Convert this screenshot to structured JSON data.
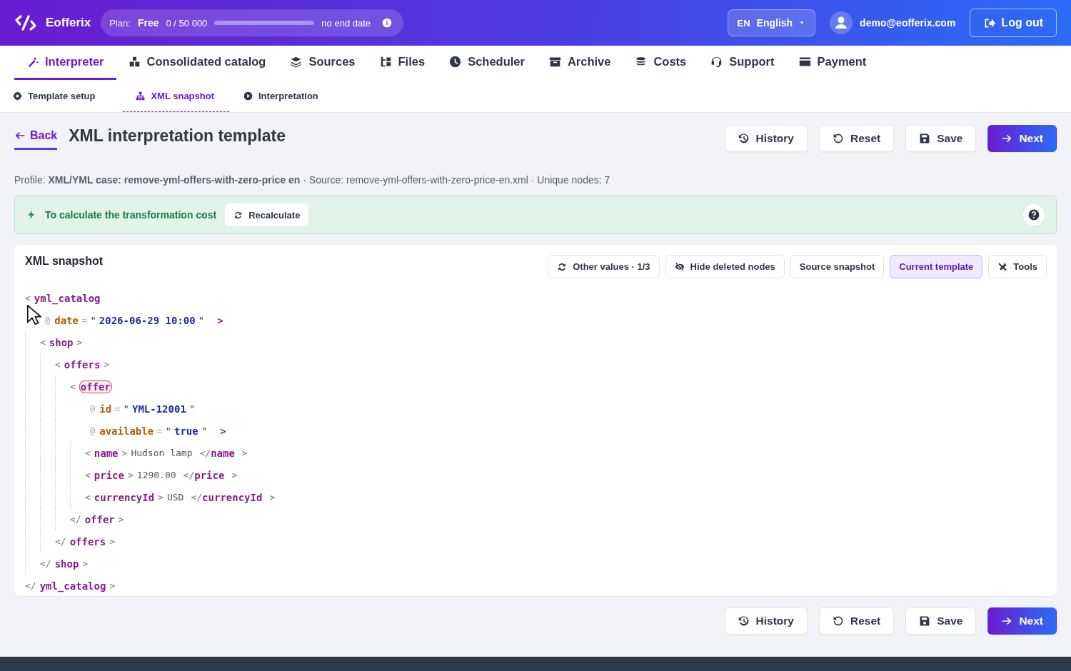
{
  "header": {
    "brand": "Eofferix",
    "plan": {
      "label": "Plan:",
      "name": "Free",
      "usage": "0 / 50 000",
      "level": 0,
      "expiry": "no end date"
    },
    "language": {
      "code": "EN",
      "name": "English"
    },
    "user": "demo@eofferix.com",
    "logout": "Log out"
  },
  "nav": [
    {
      "label": "Interpreter",
      "selected": true
    },
    {
      "label": "Consolidated catalog",
      "selected": false
    },
    {
      "label": "Sources",
      "selected": false
    },
    {
      "label": "Files",
      "selected": false
    },
    {
      "label": "Scheduler",
      "selected": false
    },
    {
      "label": "Archive",
      "selected": false
    },
    {
      "label": "Costs",
      "selected": false
    },
    {
      "label": "Support",
      "selected": false
    },
    {
      "label": "Payment",
      "selected": false
    }
  ],
  "subnav": [
    {
      "label": "Template setup",
      "selected": false
    },
    {
      "label": "XML snapshot",
      "selected": true
    },
    {
      "label": "Interpretation",
      "selected": false
    }
  ],
  "page": {
    "back": "Back",
    "title": "XML interpretation template",
    "actions": [
      {
        "label": "History",
        "kind": "default"
      },
      {
        "label": "Reset",
        "kind": "default"
      },
      {
        "label": "Save",
        "kind": "default"
      },
      {
        "label": "Next",
        "kind": "primary"
      }
    ],
    "meta": "Profile: **XML/YML case: remove-yml-offers-with-zero-price en** · Source: remove-yml-offers-with-zero-price-en.xml · Unique nodes: 7"
  },
  "alert": {
    "text": "To calculate the transformation cost",
    "button": "Recalculate"
  },
  "snapshot": {
    "title": "XML snapshot",
    "tools": [
      {
        "label": "Other values · 1/3",
        "selected": false
      },
      {
        "label": "Hide deleted nodes",
        "selected": false
      },
      {
        "label": "Source snapshot",
        "selected": false
      },
      {
        "label": "Current template",
        "selected": true
      },
      {
        "label": "Tools",
        "selected": false
      }
    ],
    "syntax": {
      "open": "<",
      "close": ">",
      "end_open": "</",
      "attr": "@",
      "eq": "=",
      "quote": "\""
    },
    "xml_tree": {
      "tag": "yml_catalog",
      "end_tag": "yml_catalog",
      "flagged": false,
      "attributes": [
        {
          "name": "date",
          "value": "2026-06-29 10:00"
        }
      ],
      "children": [
        {
          "tag": "shop",
          "end_tag": "shop",
          "flagged": false,
          "children": [
            {
              "tag": "offers",
              "end_tag": "offers",
              "flagged": false,
              "children": [
                {
                  "tag": "offer",
                  "end_tag": "offer",
                  "flagged": true,
                  "attributes": [
                    {
                      "name": "id",
                      "value": "YML-12001"
                    },
                    {
                      "name": "available",
                      "value": "true"
                    }
                  ],
                  "children": [
                    {
                      "tag": "name",
                      "end_tag": "name",
                      "flagged": false,
                      "text": "Hudson lamp"
                    },
                    {
                      "tag": "price",
                      "end_tag": "price",
                      "flagged": false,
                      "text": "1290.00"
                    },
                    {
                      "tag": "currencyId",
                      "end_tag": "currencyId",
                      "flagged": false,
                      "text": "USD"
                    }
                  ]
                }
              ]
            }
          ]
        }
      ]
    }
  },
  "bottom_actions": [
    {
      "label": "History",
      "kind": "default"
    },
    {
      "label": "Reset",
      "kind": "default"
    },
    {
      "label": "Save",
      "kind": "default"
    },
    {
      "label": "Next",
      "kind": "primary"
    }
  ]
}
